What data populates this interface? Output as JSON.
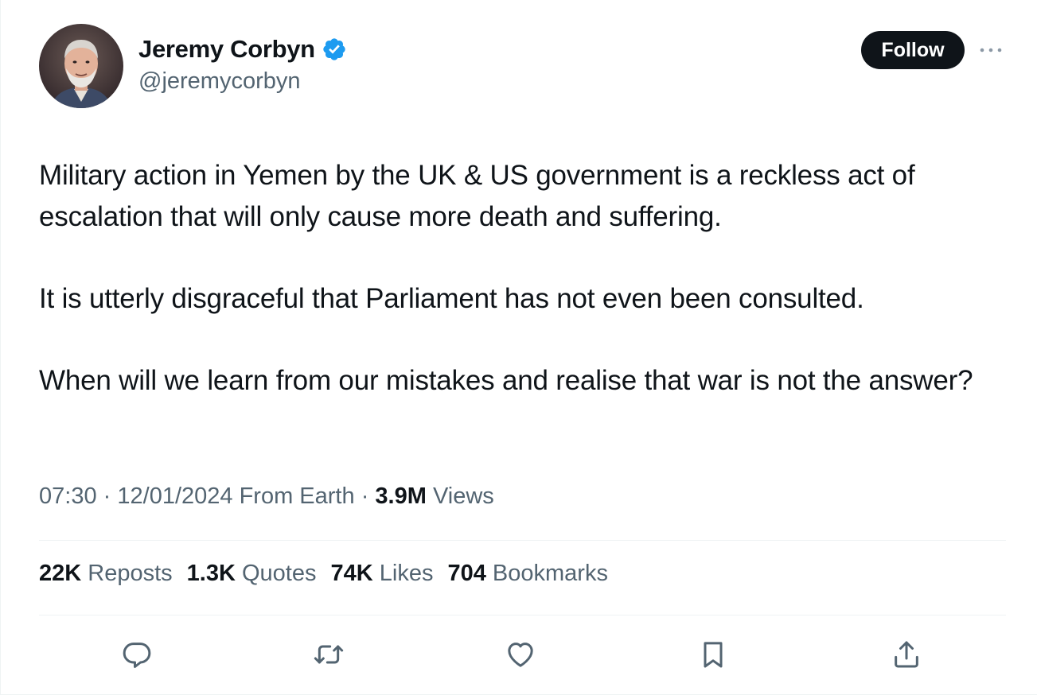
{
  "author": {
    "display_name": "Jeremy Corbyn",
    "handle": "@jeremycorbyn",
    "verified_icon": "verified-badge-icon",
    "verified_color": "#1d9bf0"
  },
  "header": {
    "follow_label": "Follow",
    "more_icon": "more-dots-icon"
  },
  "tweet": {
    "paragraphs": [
      "Military action in Yemen by the UK & US government is a reckless act of escalation that will only cause more death and suffering.",
      "It is utterly disgraceful that Parliament has not even been consulted.",
      "When will we learn from our mistakes and realise that war is not the answer?"
    ]
  },
  "meta": {
    "time": "07:30",
    "separator": "·",
    "date": "12/01/2024",
    "location": "From Earth",
    "views_count": "3.9M",
    "views_label": "Views"
  },
  "stats": [
    {
      "count": "22K",
      "label": "Reposts"
    },
    {
      "count": "1.3K",
      "label": "Quotes"
    },
    {
      "count": "74K",
      "label": "Likes"
    },
    {
      "count": "704",
      "label": "Bookmarks"
    }
  ],
  "actions": [
    {
      "icon": "reply-icon"
    },
    {
      "icon": "repost-icon"
    },
    {
      "icon": "like-icon"
    },
    {
      "icon": "bookmark-icon"
    },
    {
      "icon": "share-icon"
    }
  ],
  "colors": {
    "text_primary": "#0f1419",
    "text_secondary": "#536471",
    "accent": "#1d9bf0",
    "border": "#eff3f4"
  }
}
